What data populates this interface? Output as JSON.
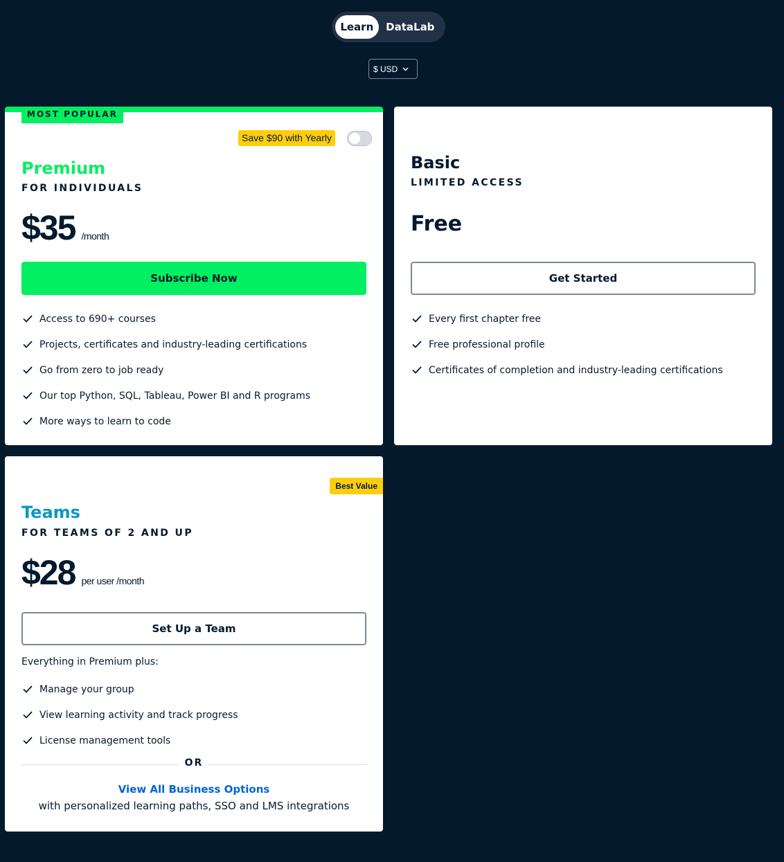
{
  "product_toggle": {
    "tabs": [
      {
        "label": "Learn",
        "active": true
      },
      {
        "label": "DataLab",
        "active": false
      }
    ]
  },
  "currency": {
    "selected": "$ USD"
  },
  "plans": {
    "premium": {
      "ribbon": "MOST POPULAR",
      "save_badge": "Save $90 with Yearly",
      "yearly_toggle_on": false,
      "name": "Premium",
      "subtitle": "FOR INDIVIDUALS",
      "price": "$35",
      "price_unit": "/month",
      "cta": "Subscribe Now",
      "features": [
        "Access to 690+ courses",
        "Projects, certificates and industry-leading certifications",
        "Go from zero to job ready",
        "Our top Python, SQL, Tableau, Power BI and R programs",
        "More ways to learn to code"
      ],
      "accent_color": "#03ef62"
    },
    "basic": {
      "name": "Basic",
      "subtitle": "LIMITED ACCESS",
      "price": "Free",
      "cta": "Get Started",
      "features": [
        "Every first chapter free",
        "Free professional profile",
        "Certificates of completion and industry-leading certifications"
      ]
    },
    "teams": {
      "badge": "Best Value",
      "name": "Teams",
      "subtitle": "FOR TEAMS OF 2 AND UP",
      "price": "$28",
      "price_unit": "per user /month",
      "cta": "Set Up a Team",
      "plus_label": "Everything in Premium plus:",
      "features": [
        "Manage your group",
        "View learning activity and track progress",
        "License management tools"
      ],
      "or_text": "OR",
      "business_link": "View All Business Options",
      "business_desc": "with personalized learning paths, SSO and LMS integrations",
      "accent_color": "#0b98c4"
    }
  },
  "colors": {
    "background": "#05192d",
    "brand_green": "#03ef62",
    "badge_yellow": "#fcce0d",
    "premium_title": "#03ef62",
    "teams_title": "#0b98c4",
    "link_blue": "#0065d1"
  }
}
